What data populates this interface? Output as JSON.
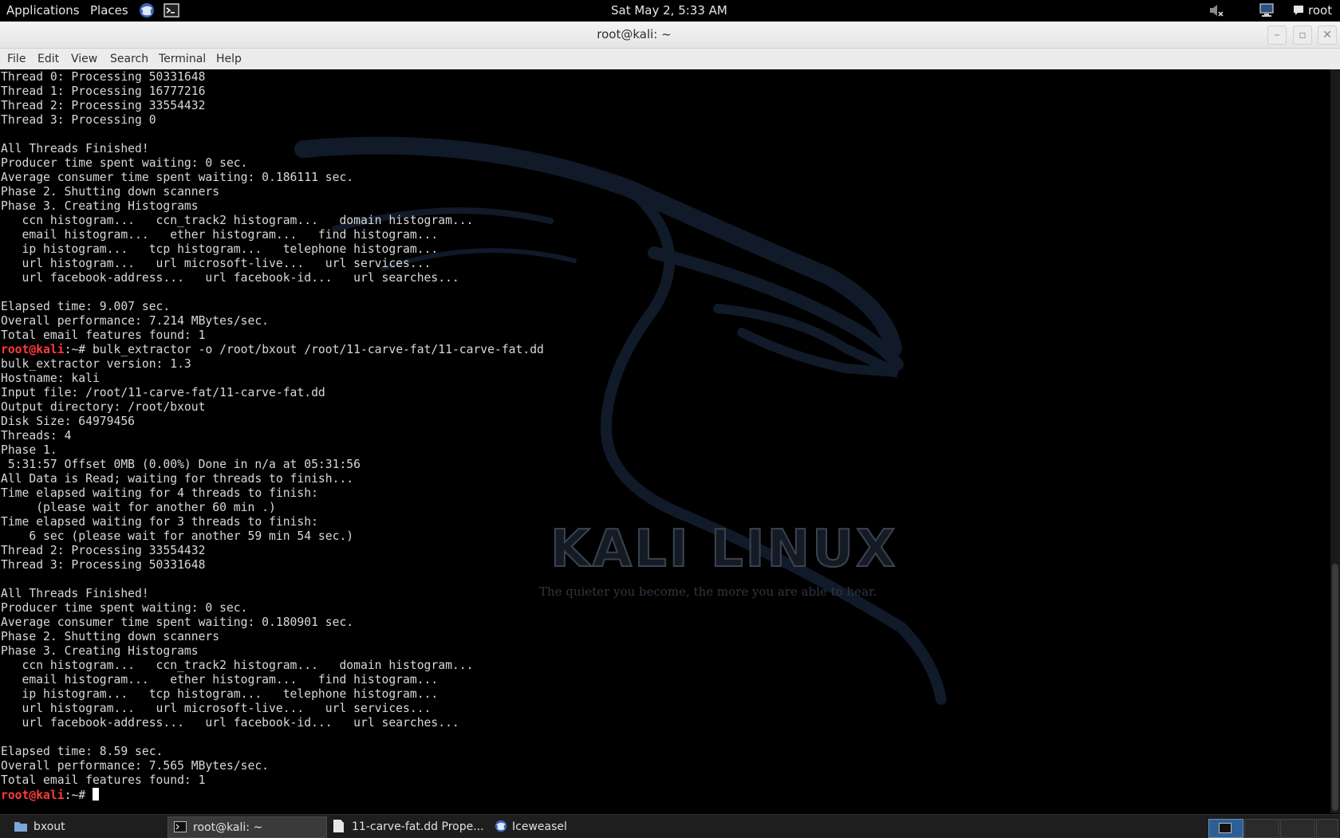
{
  "top_panel": {
    "applications": "Applications",
    "places": "Places",
    "clock": "Sat May 2,  5:33 AM",
    "user": "root"
  },
  "window": {
    "title": "root@kali: ~"
  },
  "menubar": [
    "File",
    "Edit",
    "View",
    "Search",
    "Terminal",
    "Help"
  ],
  "terminal": {
    "prompt_user": "root@kali",
    "prompt_tail": ":~#",
    "lines": [
      "Thread 0: Processing 50331648",
      "Thread 1: Processing 16777216",
      "Thread 2: Processing 33554432",
      "Thread 3: Processing 0",
      "",
      "All Threads Finished!",
      "Producer time spent waiting: 0 sec.",
      "Average consumer time spent waiting: 0.186111 sec.",
      "Phase 2. Shutting down scanners",
      "Phase 3. Creating Histograms",
      "   ccn histogram...   ccn_track2 histogram...   domain histogram...",
      "   email histogram...   ether histogram...   find histogram...",
      "   ip histogram...   tcp histogram...   telephone histogram...",
      "   url histogram...   url microsoft-live...   url services...",
      "   url facebook-address...   url facebook-id...   url searches...",
      "",
      "Elapsed time: 9.007 sec.",
      "Overall performance: 7.214 MBytes/sec.",
      "Total email features found: 1"
    ],
    "command": " bulk_extractor -o /root/bxout /root/11-carve-fat/11-carve-fat.dd",
    "lines2": [
      "bulk_extractor version: 1.3",
      "Hostname: kali",
      "Input file: /root/11-carve-fat/11-carve-fat.dd",
      "Output directory: /root/bxout",
      "Disk Size: 64979456",
      "Threads: 4",
      "Phase 1.",
      " 5:31:57 Offset 0MB (0.00%) Done in n/a at 05:31:56",
      "All Data is Read; waiting for threads to finish...",
      "Time elapsed waiting for 4 threads to finish:",
      "     (please wait for another 60 min .)",
      "Time elapsed waiting for 3 threads to finish:",
      "    6 sec (please wait for another 59 min 54 sec.)",
      "Thread 2: Processing 33554432",
      "Thread 3: Processing 50331648",
      "",
      "All Threads Finished!",
      "Producer time spent waiting: 0 sec.",
      "Average consumer time spent waiting: 0.180901 sec.",
      "Phase 2. Shutting down scanners",
      "Phase 3. Creating Histograms",
      "   ccn histogram...   ccn_track2 histogram...   domain histogram...",
      "   email histogram...   ether histogram...   find histogram...",
      "   ip histogram...   tcp histogram...   telephone histogram...",
      "   url histogram...   url microsoft-live...   url services...",
      "   url facebook-address...   url facebook-id...   url searches...",
      "",
      "Elapsed time: 8.59 sec.",
      "Overall performance: 7.565 MBytes/sec.",
      "Total email features found: 1"
    ],
    "wallpaper_logo": "KALI LINUX",
    "wallpaper_tagline": "The quieter you become, the more you are able to hear."
  },
  "taskbar": {
    "items": [
      {
        "label": "bxout",
        "icon": "folder-icon"
      },
      {
        "label": "root@kali: ~",
        "icon": "terminal-icon"
      },
      {
        "label": "11-carve-fat.dd Prope...",
        "icon": "document-icon"
      },
      {
        "label": "Iceweasel",
        "icon": "browser-icon"
      }
    ]
  }
}
